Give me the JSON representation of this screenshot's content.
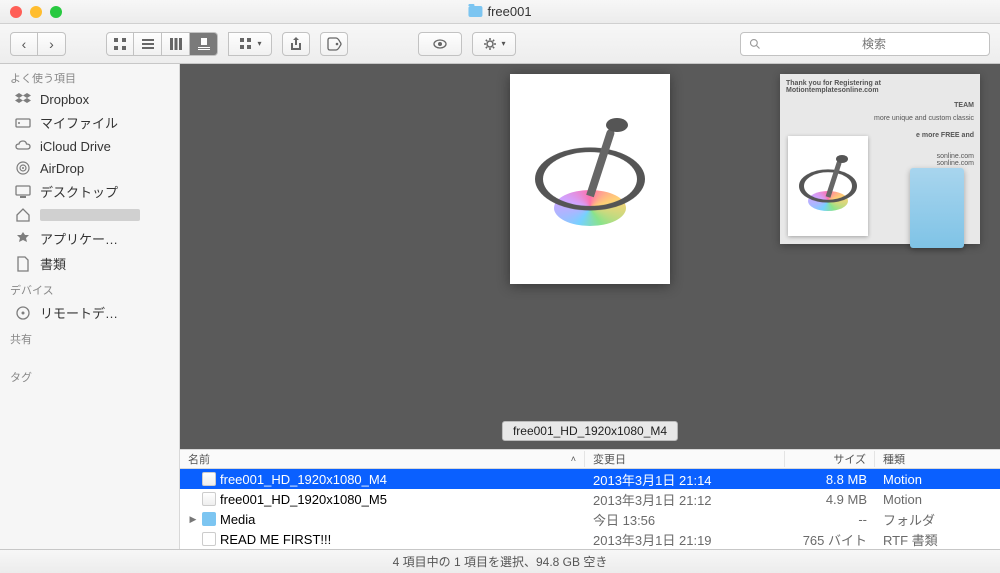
{
  "window": {
    "title": "free001"
  },
  "toolbar": {
    "search_placeholder": "検索"
  },
  "sidebar": {
    "sections": [
      {
        "label": "よく使う項目",
        "items": [
          {
            "icon": "dropbox",
            "label": "Dropbox"
          },
          {
            "icon": "drive",
            "label": "マイファイル"
          },
          {
            "icon": "cloud",
            "label": "iCloud Drive"
          },
          {
            "icon": "airdrop",
            "label": "AirDrop"
          },
          {
            "icon": "desktop",
            "label": "デスクトップ"
          },
          {
            "icon": "home",
            "label": "",
            "redacted": true
          },
          {
            "icon": "apps",
            "label": "アプリケー…"
          },
          {
            "icon": "docs",
            "label": "書類"
          }
        ]
      },
      {
        "label": "デバイス",
        "items": [
          {
            "icon": "disc",
            "label": "リモートデ…"
          }
        ]
      },
      {
        "label": "共有",
        "items": []
      },
      {
        "label": "タグ",
        "items": []
      }
    ]
  },
  "preview": {
    "label": "free001_HD_1920x1080_M4",
    "side_text_1": "Thank you for Registering at Motiontemplatesonline.com",
    "side_text_2": "TEAM",
    "side_text_3": "more unique and custom classic",
    "side_text_4": "e more FREE and",
    "side_text_5": "sonline.com",
    "side_text_6": "sonline.com"
  },
  "columns": {
    "name": "名前",
    "date": "変更日",
    "size": "サイズ",
    "kind": "種類"
  },
  "files": [
    {
      "name": "free001_HD_1920x1080_M4",
      "date": "2013年3月1日 21:14",
      "size": "8.8 MB",
      "kind": "Motion",
      "icon": "motion",
      "selected": true
    },
    {
      "name": "free001_HD_1920x1080_M5",
      "date": "2013年3月1日 21:12",
      "size": "4.9 MB",
      "kind": "Motion",
      "icon": "motion"
    },
    {
      "name": "Media",
      "date": "今日 13:56",
      "size": "--",
      "kind": "フォルダ",
      "icon": "folder",
      "expandable": true
    },
    {
      "name": "READ ME FIRST!!!",
      "date": "2013年3月1日 21:19",
      "size": "765 バイト",
      "kind": "RTF 書類",
      "icon": "rtf"
    }
  ],
  "status": "4 項目中の 1 項目を選択、94.8 GB 空き"
}
